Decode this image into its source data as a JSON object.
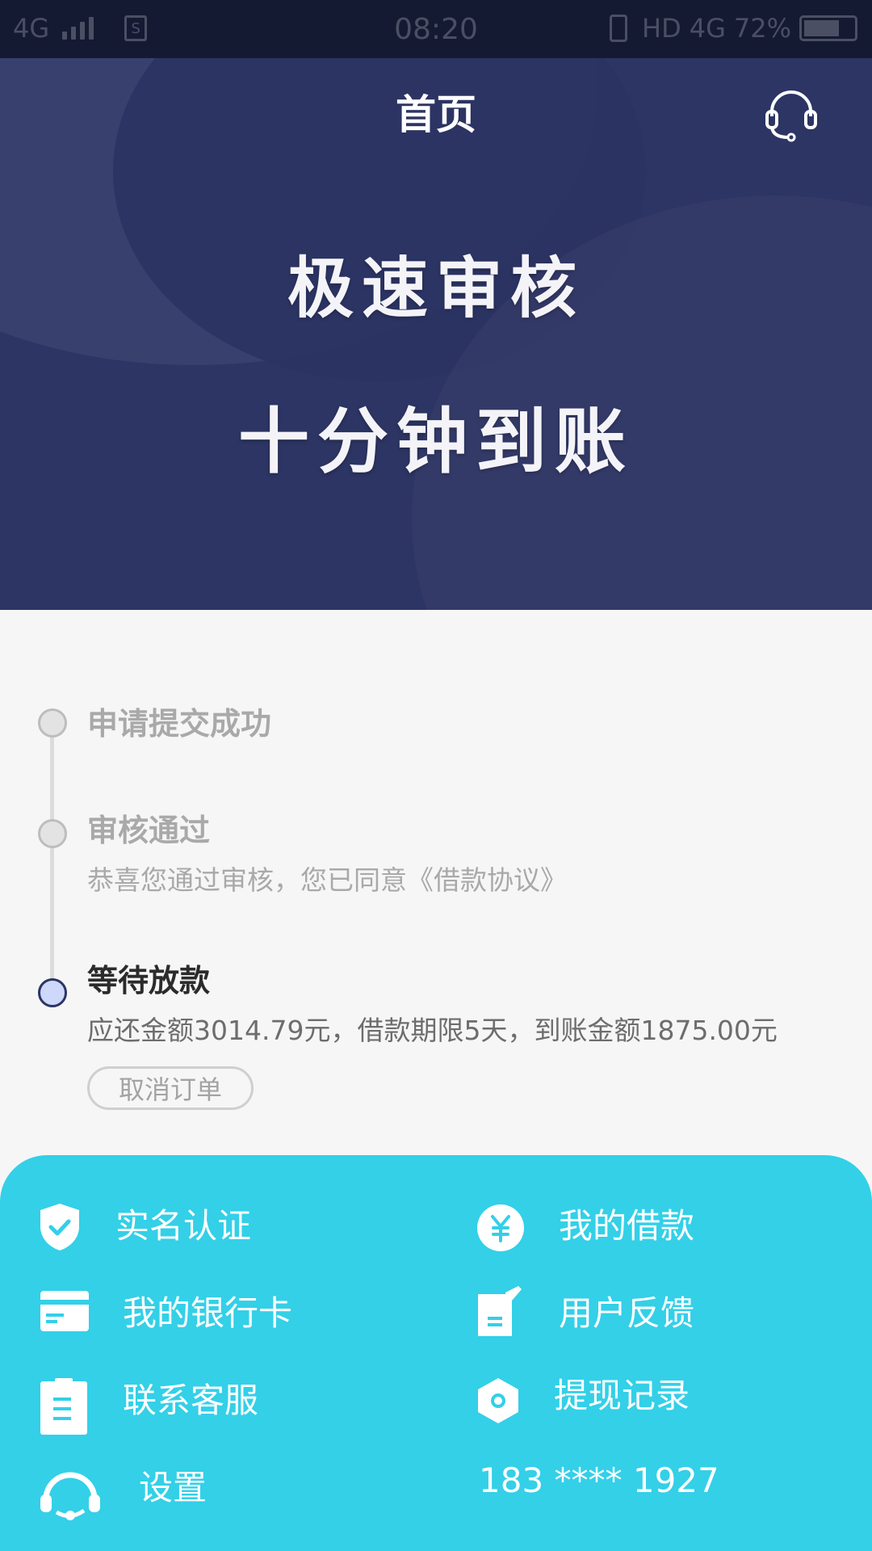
{
  "status_bar": {
    "network": "4G",
    "sim_label": "S",
    "time": "08:20",
    "hd_label": "HD",
    "network_right": "4G",
    "battery_percent": "72%",
    "battery_level": 0.72
  },
  "header": {
    "title": "首页",
    "support_icon": "headset-icon"
  },
  "banner": {
    "line1": "极速审核",
    "line2": "十分钟到账"
  },
  "timeline": {
    "steps": [
      {
        "title": "申请提交成功",
        "desc": "",
        "state": "done"
      },
      {
        "title": "审核通过",
        "desc": "恭喜您通过审核，您已同意《借款协议》",
        "state": "done"
      },
      {
        "title": "等待放款",
        "desc": "应还金额3014.79元，借款期限5天，到账金额1875.00元",
        "state": "current"
      }
    ],
    "cancel_label": "取消订单"
  },
  "menu": {
    "items": [
      {
        "label": "实名认证",
        "icon": "shield-check-icon"
      },
      {
        "label": "我的借款",
        "icon": "yen-circle-icon"
      },
      {
        "label": "我的银行卡",
        "icon": "bank-card-icon"
      },
      {
        "label": "用户反馈",
        "icon": "feedback-edit-icon"
      },
      {
        "label": "联系客服",
        "icon": "clipboard-icon"
      },
      {
        "label": "提现记录",
        "icon": "hexagon-record-icon"
      },
      {
        "label": "设置",
        "icon": "headset-icon"
      }
    ],
    "phone": "183 **** 1927"
  },
  "colors": {
    "hero_bg": "#2c3563",
    "menu_bg": "#33d0e8",
    "page_bg": "#f6f6f6",
    "active_dot": "#cdd8fb"
  }
}
